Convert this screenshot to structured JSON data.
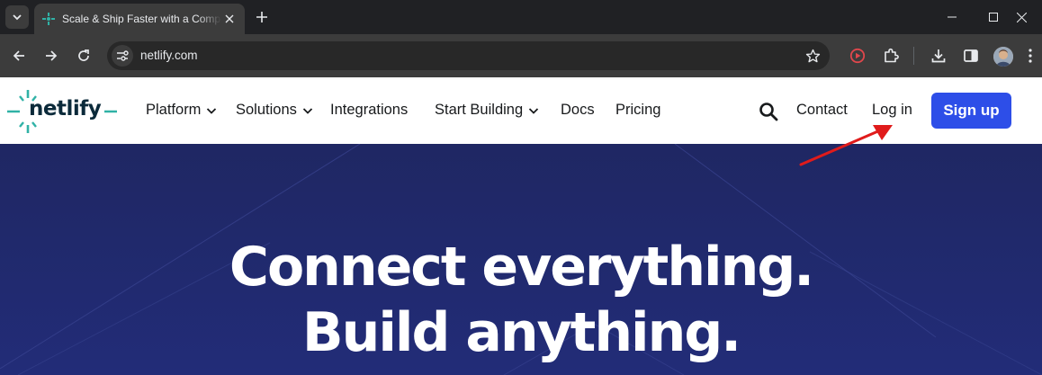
{
  "browser": {
    "tab": {
      "title": "Scale & Ship Faster with a Composable Web Architecture"
    },
    "address": {
      "url": "netlify.com"
    }
  },
  "site": {
    "logo_text": "netlify",
    "nav": {
      "platform": "Platform",
      "solutions": "Solutions",
      "integrations": "Integrations",
      "start_building": "Start Building",
      "docs": "Docs",
      "pricing": "Pricing",
      "contact": "Contact",
      "login": "Log in",
      "signup": "Sign up"
    },
    "hero": {
      "line1": "Connect everything.",
      "line2": "Build anything."
    }
  },
  "colors": {
    "brand_teal": "#30b2a6",
    "signup_blue": "#2d4ee8",
    "hero_navy": "#1f2763",
    "annotation_red": "#e01b1b",
    "record_icon_red": "#e0474c"
  },
  "icons": [
    "tab-search-icon",
    "netlify-favicon-icon",
    "close-icon",
    "plus-icon",
    "minimize-icon",
    "maximize-icon",
    "window-close-icon",
    "back-icon",
    "forward-icon",
    "reload-icon",
    "site-info-icon",
    "bookmark-star-icon",
    "record-icon",
    "extensions-icon",
    "download-icon",
    "side-panel-icon",
    "menu-icon",
    "search-icon",
    "chevron-down-icon"
  ]
}
